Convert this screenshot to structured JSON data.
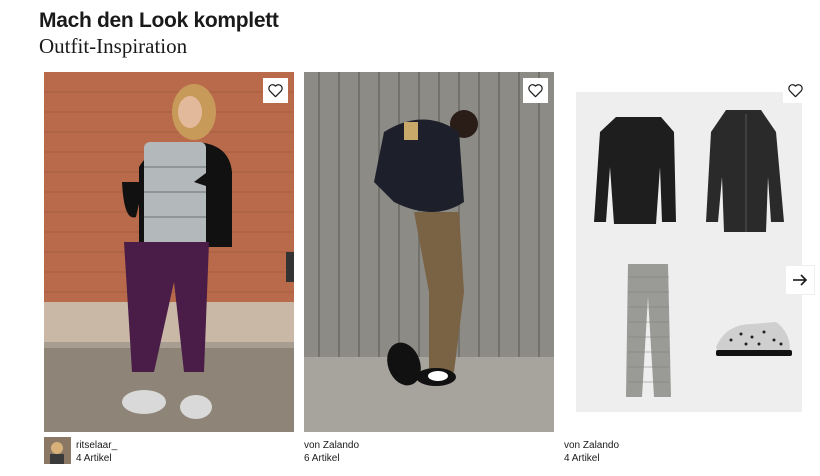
{
  "header": {
    "title": "Mach den Look komplett",
    "subtitle": "Outfit-Inspiration"
  },
  "outfits": [
    {
      "author": "ritselaar_",
      "count": "4 Artikel"
    },
    {
      "author": "von Zalando",
      "count": "6 Artikel"
    },
    {
      "author": "von Zalando",
      "count": "4 Artikel"
    }
  ],
  "icons": {
    "favorite": "heart-icon",
    "next": "arrow-right-icon"
  }
}
